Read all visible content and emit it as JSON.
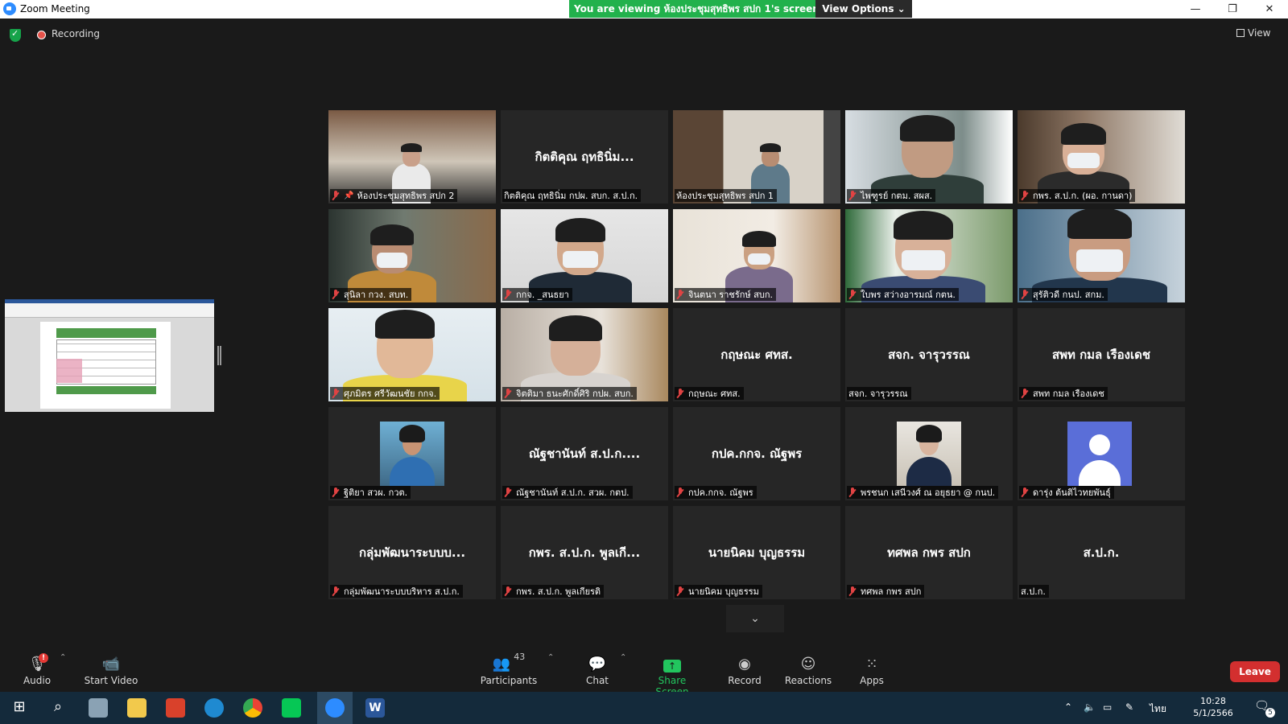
{
  "window": {
    "title": "Zoom Meeting",
    "share_banner": "You are viewing ห้องประชุมสุทธิพร สปก 1's screen",
    "view_options": "View Options ⌄",
    "minimize": "—",
    "restore": "❐",
    "close": "✕"
  },
  "status": {
    "recording": "Recording",
    "view": "View"
  },
  "gallery": [
    {
      "label": "ห้องประชุมสุทธิพร สปก 2",
      "big_name": "",
      "pinned": true,
      "muted": true,
      "active": false,
      "type": "video-room"
    },
    {
      "label": "กิตติคุณ ฤทธินิ่ม กปผ. สบก. ส.ป.ก.",
      "big_name": "กิตติคุณ ฤทธินิ่ม...",
      "pinned": false,
      "muted": false,
      "active": false,
      "type": "name"
    },
    {
      "label": "ห้องประชุมสุทธิพร สปก 1",
      "big_name": "",
      "pinned": false,
      "muted": false,
      "active": true,
      "type": "video-office"
    },
    {
      "label": "ไพฑูรย์  กตม. สผส.",
      "big_name": "",
      "pinned": false,
      "muted": true,
      "active": false,
      "type": "video-man"
    },
    {
      "label": "กพร. ส.ป.ก. (ผอ. กานดา)",
      "big_name": "",
      "pinned": false,
      "muted": true,
      "active": false,
      "type": "video-woman"
    },
    {
      "label": "สุนิลา กวง. สบท.",
      "big_name": "",
      "pinned": false,
      "muted": true,
      "active": false,
      "type": "video-woman2"
    },
    {
      "label": "กกจ. _สนธยา",
      "big_name": "",
      "pinned": false,
      "muted": true,
      "active": false,
      "type": "video-man2"
    },
    {
      "label": "จินตนา  ราชรักษ์ สบก.",
      "big_name": "",
      "pinned": false,
      "muted": true,
      "active": false,
      "type": "video-woman3"
    },
    {
      "label": "ใบพร สว่างอารมณ์ กตน.",
      "big_name": "",
      "pinned": false,
      "muted": true,
      "active": false,
      "type": "video-woman4"
    },
    {
      "label": "สุรัติวดี กนป. สกม.",
      "big_name": "",
      "pinned": false,
      "muted": true,
      "active": false,
      "type": "video-woman5"
    },
    {
      "label": "ศุภมิตร ศรีวัฒนชัย กกจ.",
      "big_name": "",
      "pinned": false,
      "muted": true,
      "active": false,
      "type": "video-man3"
    },
    {
      "label": "จิตติมา ธนะศักดิ์ศิริ  กปผ. สบก.",
      "big_name": "",
      "pinned": false,
      "muted": true,
      "active": false,
      "type": "video-woman6"
    },
    {
      "label": "กฤษณะ ศทส.",
      "big_name": "กฤษณะ ศทส.",
      "pinned": false,
      "muted": true,
      "active": false,
      "type": "name"
    },
    {
      "label": "สจก. จารุวรรณ",
      "big_name": "สจก. จารุวรรณ",
      "pinned": false,
      "muted": false,
      "active": false,
      "type": "name"
    },
    {
      "label": "สพท กมล เรืองเดช",
      "big_name": "สพท กมล เรืองเดช",
      "pinned": false,
      "muted": true,
      "active": false,
      "type": "name"
    },
    {
      "label": "ฐิติยา สวผ. กวต.",
      "big_name": "",
      "pinned": false,
      "muted": true,
      "active": false,
      "type": "photo1"
    },
    {
      "label": "ณัฐชานันท์ ส.ป.ก. สวผ. กตป.",
      "big_name": "ณัฐชานันท์ ส.ป.ก....",
      "pinned": false,
      "muted": true,
      "active": false,
      "type": "name"
    },
    {
      "label": "กปค.กกจ. ณัฐพร",
      "big_name": "กปค.กกจ. ณัฐพร",
      "pinned": false,
      "muted": true,
      "active": false,
      "type": "name"
    },
    {
      "label": "พรชนก เสนีวงศ์ ณ อยุธยา @ กนป.",
      "big_name": "",
      "pinned": false,
      "muted": true,
      "active": false,
      "type": "photo2"
    },
    {
      "label": "ดารุ่ง ต้นติไวทยพันธุ์",
      "big_name": "",
      "pinned": false,
      "muted": true,
      "active": false,
      "type": "avatar"
    },
    {
      "label": "กลุ่มพัฒนาระบบบริหาร ส.ป.ก.",
      "big_name": "กลุ่มพัฒนาระบบบ...",
      "pinned": false,
      "muted": true,
      "active": false,
      "type": "name"
    },
    {
      "label": "กพร. ส.ป.ก. พูลเกียรติ",
      "big_name": "กพร. ส.ป.ก. พูลเกี...",
      "pinned": false,
      "muted": true,
      "active": false,
      "type": "name"
    },
    {
      "label": "นายนิคม บุญธรรม",
      "big_name": "นายนิคม บุญธรรม",
      "pinned": false,
      "muted": true,
      "active": false,
      "type": "name"
    },
    {
      "label": "ทศพล กพร สปก",
      "big_name": "ทศพล กพร สปก",
      "pinned": false,
      "muted": true,
      "active": false,
      "type": "name"
    },
    {
      "label": "ส.ป.ก.",
      "big_name": "ส.ป.ก.",
      "pinned": false,
      "muted": false,
      "active": false,
      "type": "name"
    }
  ],
  "toolbar": {
    "audio": "Audio",
    "audio_badge": "!",
    "start_video": "Start Video",
    "participants": "Participants",
    "participants_count": "43",
    "chat": "Chat",
    "share_screen": "Share Screen",
    "record": "Record",
    "reactions": "Reactions",
    "apps": "Apps",
    "leave": "Leave"
  },
  "taskbar": {
    "language": "ไทย",
    "time": "10:28",
    "date": "5/1/2566",
    "notification_count": "5"
  },
  "colors": {
    "accent_green": "#22b14c",
    "active_speaker": "#c3e34b",
    "leave_red": "#d32f2f",
    "zoom_blue": "#2d8cff"
  }
}
